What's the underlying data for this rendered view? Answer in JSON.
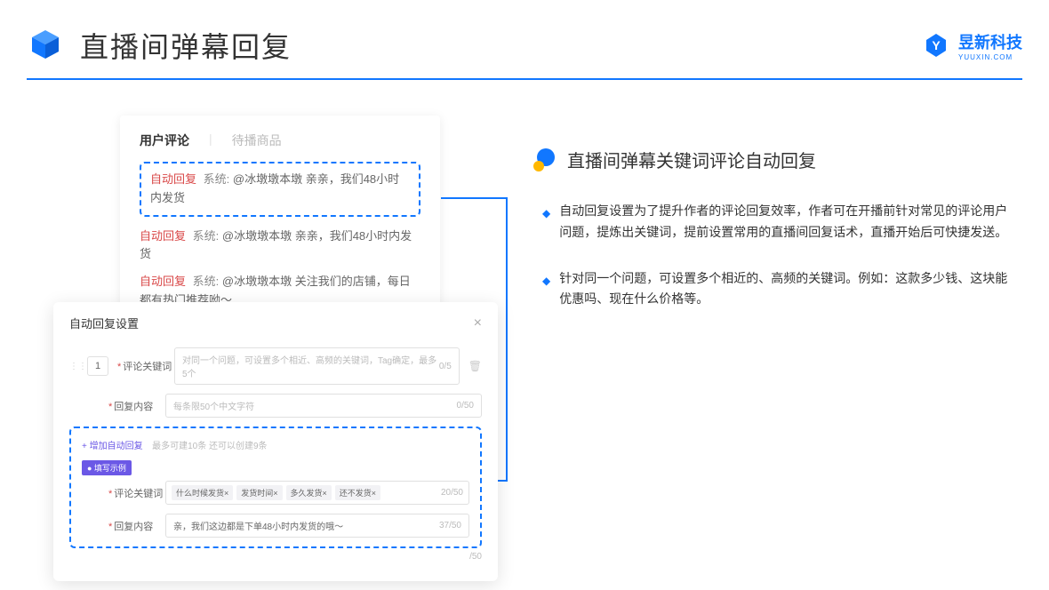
{
  "header": {
    "title": "直播间弹幕回复",
    "brand_name": "昱新科技",
    "brand_sub": "YUUXIN.COM"
  },
  "comments": {
    "tab_active": "用户评论",
    "tab_inactive": "待播商品",
    "badge": "自动回复",
    "sys": "系统:",
    "line1": "@冰墩墩本墩 亲亲，我们48小时内发货",
    "line2": "@冰墩墩本墩 亲亲，我们48小时内发货",
    "line3": "@冰墩墩本墩 关注我们的店铺，每日都有热门推荐呦～"
  },
  "modal": {
    "title": "自动回复设置",
    "index": "1",
    "field1_label": "评论关键词",
    "field1_placeholder": "对同一个问题，可设置多个相近、高频的关键词，Tag确定，最多5个",
    "field1_counter": "0/5",
    "field2_label": "回复内容",
    "field2_placeholder": "每条限50个中文字符",
    "field2_counter": "0/50",
    "add_text": "+ 增加自动回复",
    "add_hint": "最多可建10条 还可以创建9条",
    "example_badge": "● 填写示例",
    "ex_field1": "评论关键词",
    "ex_tags": [
      "什么时候发货×",
      "发货时间×",
      "多久发货×",
      "还不发货×"
    ],
    "ex_counter1": "20/50",
    "ex_field2": "回复内容",
    "ex_value2": "亲，我们这边都是下单48小时内发货的哦～",
    "ex_counter2": "37/50",
    "bottom_counter": "/50"
  },
  "right": {
    "section_title": "直播间弹幕关键词评论自动回复",
    "bullet1": "自动回复设置为了提升作者的评论回复效率，作者可在开播前针对常见的评论用户问题，提炼出关键词，提前设置常用的直播间回复话术，直播开始后可快捷发送。",
    "bullet2": "针对同一个问题，可设置多个相近的、高频的关键词。例如：这款多少钱、这块能优惠吗、现在什么价格等。"
  }
}
